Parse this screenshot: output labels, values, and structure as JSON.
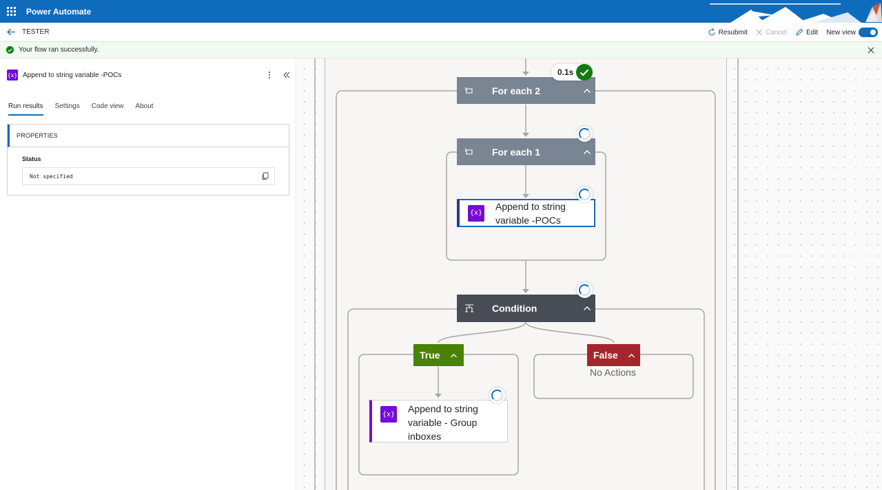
{
  "header": {
    "app_name": "Power Automate"
  },
  "command_bar": {
    "flow_name": "TESTER",
    "resubmit": "Resubmit",
    "cancel": "Cancel",
    "edit": "Edit",
    "new_view": "New view",
    "new_view_on": true
  },
  "message": {
    "text": "Your flow ran successfully."
  },
  "panel": {
    "title": "Append to string variable -POCs",
    "icon": "{x}",
    "tabs": [
      {
        "label": "Run results",
        "active": true
      },
      {
        "label": "Settings",
        "active": false
      },
      {
        "label": "Code view",
        "active": false
      },
      {
        "label": "About",
        "active": false
      }
    ],
    "properties_header": "PROPERTIES",
    "status_label": "Status",
    "status_value": "Not specified"
  },
  "canvas": {
    "for_each_2": {
      "label": "For each 2",
      "duration": "0.1s"
    },
    "for_each_1": {
      "label": "For each 1"
    },
    "append_pocs": {
      "line1": "Append to string",
      "line2": "variable -POCs",
      "icon": "{x}"
    },
    "condition": {
      "label": "Condition"
    },
    "true_branch": {
      "label": "True"
    },
    "false_branch": {
      "label": "False",
      "empty_text": "No Actions"
    },
    "append_group": {
      "line1": "Append to string",
      "line2": "variable - Group",
      "line3": "inboxes",
      "icon": "{x}"
    }
  },
  "colors": {
    "brand": "#0f6cbd",
    "scope_header": "#7a8593",
    "condition_header": "#474c55",
    "true_branch": "#498205",
    "false_branch": "#a4262c",
    "variable_icon": "#770bd6",
    "success": "#107c10"
  }
}
